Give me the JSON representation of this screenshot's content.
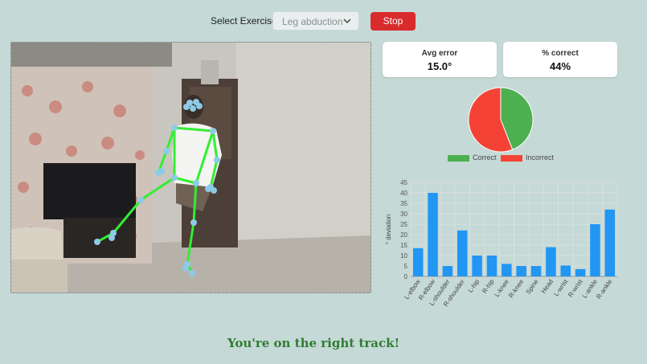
{
  "controls": {
    "exercise_label": "Select Exercise:",
    "exercise_value": "Leg abduction",
    "stop_label": "Stop",
    "stop_color": "#d92b2b"
  },
  "stats": {
    "avg_error_title": "Avg error",
    "avg_error_value": "15.0°",
    "pct_correct_title": "% correct",
    "pct_correct_value": "44%"
  },
  "colors": {
    "correct": "#4caf50",
    "incorrect": "#f44336",
    "bar": "#2196f3",
    "skeleton": "#33ee33",
    "joint": "#8ecae6"
  },
  "feedback": "You're on the right track!",
  "chart_data": [
    {
      "type": "pie",
      "labels": [
        "Correct",
        "Incorrect"
      ],
      "values": [
        44,
        56
      ],
      "colors": [
        "#4caf50",
        "#f44336"
      ],
      "legend": "bottom"
    },
    {
      "type": "bar",
      "categories": [
        "L-elbow",
        "R-elbow",
        "L-shoulder",
        "R-shoulder",
        "L-hip",
        "R-hip",
        "L-knee",
        "R-knee",
        "Spine",
        "Head",
        "L-wrist",
        "R-wrist",
        "L-ankle",
        "R-ankle"
      ],
      "values": [
        13.5,
        40,
        5,
        22,
        10,
        10,
        6,
        5,
        5,
        14,
        5.2,
        3.5,
        25,
        32
      ],
      "ylabel": "° deviation",
      "ylim": [
        0,
        45
      ],
      "yticks": [
        0,
        5,
        10,
        15,
        20,
        25,
        30,
        35,
        40,
        45
      ],
      "grid": true,
      "color": "#2196f3"
    }
  ]
}
